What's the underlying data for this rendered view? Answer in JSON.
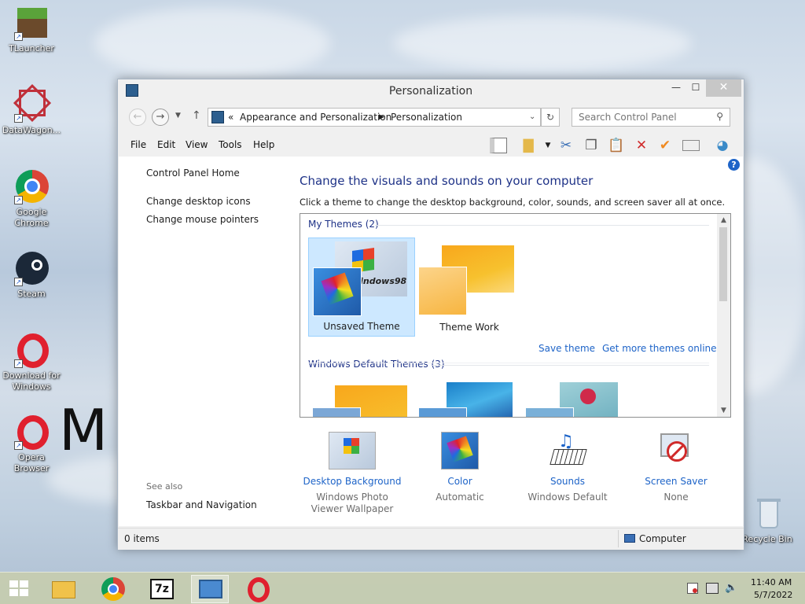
{
  "desktop": {
    "icons": [
      {
        "label": "TLauncher"
      },
      {
        "label": "DataWagon..."
      },
      {
        "label": "Google Chrome"
      },
      {
        "label": "Steam"
      },
      {
        "label": "Download for Windows"
      },
      {
        "label": "Opera Browser"
      },
      {
        "label": "Recycle Bin"
      }
    ],
    "background_text": "M"
  },
  "window": {
    "title": "Personalization",
    "address": {
      "prefix": "«",
      "crumbs": [
        "Appearance and Personalization",
        "Personalization"
      ]
    },
    "search_placeholder": "Search Control Panel",
    "menu": [
      "File",
      "Edit",
      "View",
      "Tools",
      "Help"
    ],
    "sidebar": {
      "home": "Control Panel Home",
      "links": [
        "Change desktop icons",
        "Change mouse pointers"
      ],
      "see_also_label": "See also",
      "see_also_links": [
        "Taskbar and Navigation"
      ]
    },
    "main": {
      "title": "Change the visuals and sounds on your computer",
      "description": "Click a theme to change the desktop background, color, sounds, and screen saver all at once.",
      "my_themes_header": "My Themes (2)",
      "my_themes": [
        {
          "name": "Unsaved Theme",
          "selected": true
        },
        {
          "name": "Theme Work",
          "selected": false
        }
      ],
      "save_theme": "Save theme",
      "get_more": "Get more themes online",
      "default_themes_header": "Windows Default Themes (3)"
    },
    "bottom": [
      {
        "label": "Desktop Background",
        "sub": "Windows Photo Viewer Wallpaper"
      },
      {
        "label": "Color",
        "sub": "Automatic"
      },
      {
        "label": "Sounds",
        "sub": "Windows Default"
      },
      {
        "label": "Screen Saver",
        "sub": "None"
      }
    ],
    "status": {
      "items": "0 items",
      "location": "Computer"
    }
  },
  "taskbar": {
    "clock_time": "11:40 AM",
    "clock_date": "5/7/2022",
    "apps": [
      "file-explorer",
      "chrome",
      "7zip",
      "control-panel",
      "opera"
    ]
  }
}
